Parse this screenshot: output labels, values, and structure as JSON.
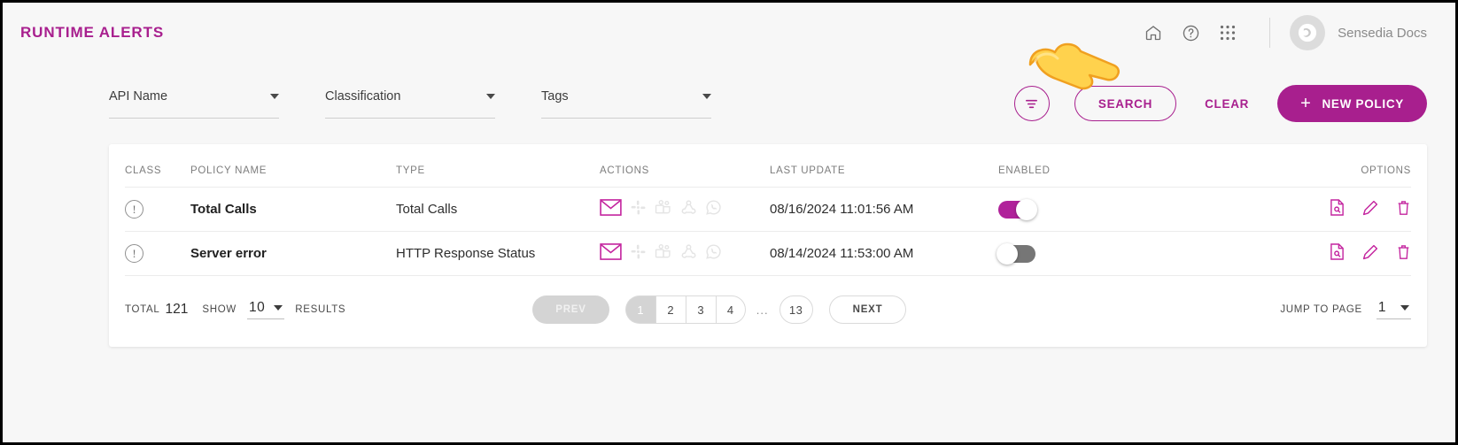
{
  "header": {
    "title": "RUNTIME ALERTS",
    "icons": [
      "home-icon",
      "help-icon",
      "apps-grid-icon"
    ],
    "user_name": "Sensedia Docs",
    "brand_color": "#a81f8e"
  },
  "filters": {
    "fields": [
      {
        "label": "API Name",
        "name": "api-name"
      },
      {
        "label": "Classification",
        "name": "classification"
      },
      {
        "label": "Tags",
        "name": "tags"
      }
    ],
    "filter_icon": "filter-icon",
    "search_label": "SEARCH",
    "clear_label": "CLEAR",
    "new_policy_label": "NEW POLICY",
    "new_policy_plus": "+"
  },
  "table": {
    "columns": [
      "CLASS",
      "POLICY NAME",
      "TYPE",
      "ACTIONS",
      "LAST UPDATE",
      "ENABLED",
      "OPTIONS"
    ],
    "rows": [
      {
        "class_icon": "alert-circle-icon",
        "policy_name": "Total Calls",
        "type": "Total Calls",
        "actions": [
          "email-icon",
          "slack-icon",
          "teams-icon",
          "webhook-icon",
          "whatsapp-icon"
        ],
        "active_action": "email-icon",
        "last_update": "08/16/2024 11:01:56 AM",
        "enabled": true,
        "options": [
          "view-log-icon",
          "edit-icon",
          "delete-icon"
        ]
      },
      {
        "class_icon": "alert-circle-icon",
        "policy_name": "Server error",
        "type": "HTTP Response Status",
        "actions": [
          "email-icon",
          "slack-icon",
          "teams-icon",
          "webhook-icon",
          "whatsapp-icon"
        ],
        "active_action": "email-icon",
        "last_update": "08/14/2024 11:53:00 AM",
        "enabled": false,
        "options": [
          "view-log-icon",
          "edit-icon",
          "delete-icon"
        ]
      }
    ]
  },
  "footer": {
    "total_label": "TOTAL",
    "total_value": "121",
    "show_label": "SHOW",
    "show_value": "10",
    "results_label": "RESULTS",
    "prev_label": "PREV",
    "pages": [
      "1",
      "2",
      "3",
      "4"
    ],
    "active_page": "1",
    "ellipsis": "...",
    "last_page": "13",
    "next_label": "NEXT",
    "jump_label": "JUMP TO PAGE",
    "jump_value": "1"
  },
  "cursor": {
    "type": "pointing-hand-cursor"
  }
}
